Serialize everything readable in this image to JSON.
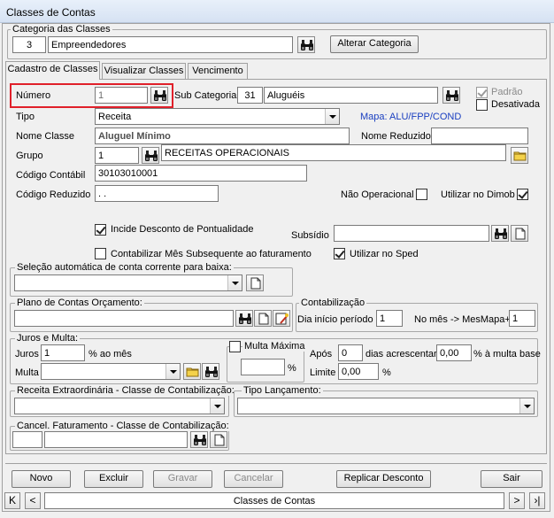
{
  "window": {
    "title": "Classes de Contas"
  },
  "categoria": {
    "group_label": "Categoria das Classes",
    "code": "3",
    "name": "Empreendedores",
    "alterar_label": "Alterar Categoria"
  },
  "tabs": [
    {
      "label": "Cadastro de Classes"
    },
    {
      "label": "Visualizar Classes"
    },
    {
      "label": "Vencimento"
    }
  ],
  "form": {
    "numero_label": "Número",
    "numero_value": "1",
    "subcat_label": "Sub Categoria",
    "subcat_code": "31",
    "subcat_name": "Aluguéis",
    "padrao_label": "Padrão",
    "desativada_label": "Desativada",
    "tipo_label": "Tipo",
    "tipo_value": "Receita",
    "mapa_text": "Mapa: ALU/FPP/COND",
    "nome_classe_label": "Nome Classe",
    "nome_classe_value": "Aluguel Mínimo",
    "nome_reduzido_label": "Nome Reduzido",
    "nome_reduzido_value": "",
    "grupo_label": "Grupo",
    "grupo_code": "1",
    "grupo_name": "RECEITAS OPERACIONAIS",
    "codigo_contabil_label": "Código Contábil",
    "codigo_contabil_value": "30103010001",
    "codigo_reduzido_label": "Código Reduzido",
    "codigo_reduzido_value": ". .",
    "nao_operacional_label": "Não Operacional",
    "utilizar_dimob_label": "Utilizar no Dimob",
    "incide_desconto_label": "Incide Desconto de Pontualidade",
    "subsidio_label": "Subsídio",
    "contabilizar_mes_label": "Contabilizar Mês Subsequente ao faturamento",
    "utilizar_sped_label": "Utilizar no Sped"
  },
  "selecao": {
    "label": "Seleção automática de conta corrente para baixa:"
  },
  "plano": {
    "label": "Plano de Contas Orçamento:"
  },
  "contabilizacao": {
    "label": "Contabilização",
    "dia_label": "Dia início período",
    "dia_value": "1",
    "no_mes_label": "No mês -> MesMapa+",
    "no_mes_value": "1"
  },
  "juros": {
    "group_label": "Juros e Multa:",
    "juros_label": "Juros",
    "juros_value": "1",
    "ao_mes_label": "% ao mês",
    "multa_label": "Multa",
    "multa_maxima_label": "Multa Máxima",
    "pct_label": "%",
    "apos_label": "Após",
    "apos_value": "0",
    "dias_label": "dias acrescentar",
    "dias_value": "0,00",
    "multa_base_label": "% à multa base",
    "limite_label": "Limite",
    "limite_value": "0,00",
    "limite_pct": "%"
  },
  "receita_extra": {
    "label": "Receita Extraordinária - Classe de Contabilização:"
  },
  "tipo_lancamento": {
    "label": "Tipo Lançamento:"
  },
  "cancel_fat": {
    "label": "Cancel. Faturamento - Classe de Contabilização:"
  },
  "buttons": {
    "novo": "Novo",
    "excluir": "Excluir",
    "gravar": "Gravar",
    "cancelar": "Cancelar",
    "replicar": "Replicar Desconto",
    "sair": "Sair"
  },
  "nav": {
    "first": "K",
    "prev": "<",
    "label": "Classes de Contas",
    "next": ">",
    "last": "›|"
  },
  "colors": {
    "highlight": "#e0202a",
    "mapa_blue": "#1a3fc0"
  }
}
